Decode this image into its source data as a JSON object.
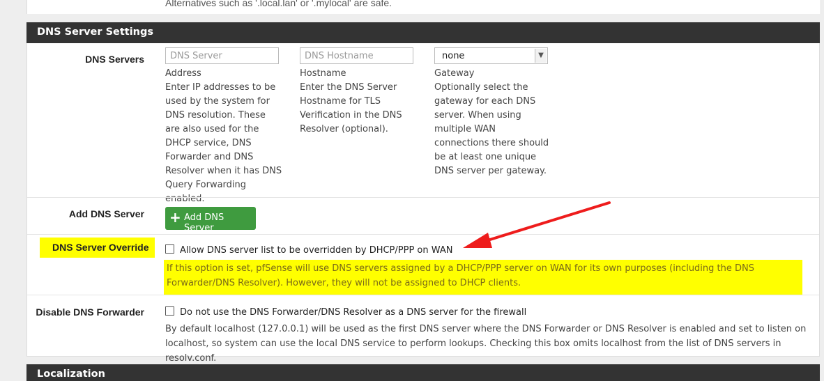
{
  "top_help": "Alternatives such as '.local.lan' or '.mylocal' are safe.",
  "dns_panel": {
    "title": "DNS Server Settings",
    "dns_servers": {
      "label": "DNS Servers",
      "address_placeholder": "DNS Server",
      "hostname_placeholder": "DNS Hostname",
      "gateway_value": "none",
      "address_help_title": "Address",
      "address_help": "Enter IP addresses to be used by the system for DNS resolution. These are also used for the DHCP service, DNS Forwarder and DNS Resolver when it has DNS Query Forwarding enabled.",
      "hostname_help_title": "Hostname",
      "hostname_help": "Enter the DNS Server Hostname for TLS Verification in the DNS Resolver (optional).",
      "gateway_help_title": "Gateway",
      "gateway_help": "Optionally select the gateway for each DNS server. When using multiple WAN connections there should be at least one unique DNS server per gateway."
    },
    "add_dns": {
      "label": "Add DNS Server",
      "button": "Add DNS Server"
    },
    "override": {
      "label": "DNS Server Override",
      "checkbox_label": "Allow DNS server list to be overridden by DHCP/PPP on WAN",
      "checked": false,
      "help": "If this option is set, pfSense will use DNS servers assigned by a DHCP/PPP server on WAN for its own purposes (including the DNS Forwarder/DNS Resolver). However, they will not be assigned to DHCP clients."
    },
    "disable_forwarder": {
      "label": "Disable DNS Forwarder",
      "checkbox_label": "Do not use the DNS Forwarder/DNS Resolver as a DNS server for the firewall",
      "checked": false,
      "help": "By default localhost (127.0.0.1) will be used as the first DNS server where the DNS Forwarder or DNS Resolver is enabled and set to listen on localhost, so system can use the local DNS service to perform lookups. Checking this box omits localhost from the list of DNS servers in resolv.conf."
    }
  },
  "localization_panel": {
    "title": "Localization"
  },
  "colors": {
    "highlight": "#ffff00",
    "heading_bg": "#333333",
    "button_green": "#3f9b3f",
    "arrow": "#ee1c1c"
  },
  "icons": {
    "plus": "plus-icon",
    "select_arrow": "chevron-down-icon",
    "annotation": "red-arrow-annotation"
  }
}
